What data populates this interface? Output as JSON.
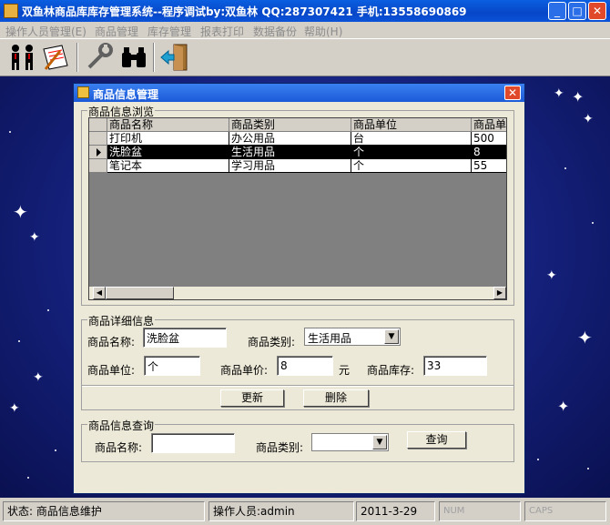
{
  "window": {
    "title": "双鱼林商品库库存管理系统--程序调试by:双鱼林 QQ:287307421 手机:13558690869",
    "min_symbol": "_",
    "max_symbol": "□",
    "close_symbol": "✕"
  },
  "menu": [
    {
      "label": "操作人员管理(E)"
    },
    {
      "label": "商品管理"
    },
    {
      "label": "库存管理"
    },
    {
      "label": "报表打印"
    },
    {
      "label": "数据备份"
    },
    {
      "label": "帮助(H)"
    }
  ],
  "toolbar": {
    "icons": [
      "people-icon",
      "edit-note-icon",
      "tools-icon",
      "binoculars-icon",
      "exit-door-icon"
    ]
  },
  "dialog": {
    "title": "商品信息管理",
    "close_symbol": "✕",
    "browse_group": "商品信息浏览",
    "grid": {
      "columns": [
        "商品名称",
        "商品类别",
        "商品单位",
        "商品单"
      ],
      "rows": [
        {
          "name": "打印机",
          "category": "办公用品",
          "unit": "台",
          "price": "500",
          "selected": false
        },
        {
          "name": "洗脸盆",
          "category": "生活用品",
          "unit": "个",
          "price": "8",
          "selected": true
        },
        {
          "name": "笔记本",
          "category": "学习用品",
          "unit": "个",
          "price": "55",
          "selected": false
        }
      ],
      "scroll_left": "◀",
      "scroll_right": "▶"
    },
    "detail_group": "商品详细信息",
    "detail": {
      "name_label": "商品名称:",
      "name_value": "洗脸盆",
      "category_label": "商品类别:",
      "category_value": "生活用品",
      "unit_label": "商品单位:",
      "unit_value": "个",
      "price_label": "商品单价:",
      "price_value": "8",
      "price_unit": "元",
      "stock_label": "商品库存:",
      "stock_value": "33"
    },
    "buttons": {
      "update": "更新",
      "delete": "删除"
    },
    "query_group": "商品信息查询",
    "query": {
      "name_label": "商品名称:",
      "name_value": "",
      "category_label": "商品类别:",
      "category_value": "",
      "search_button": "查询"
    }
  },
  "statusbar": {
    "status": "状态: 商品信息维护",
    "operator": "操作人员:admin",
    "date": "2011-3-29",
    "num": "NUM",
    "caps": "CAPS"
  }
}
